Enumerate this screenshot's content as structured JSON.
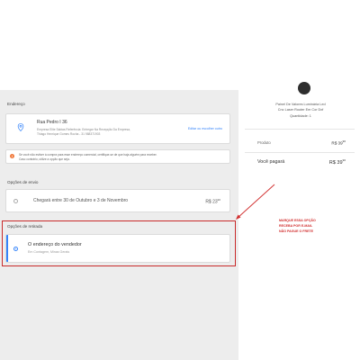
{
  "address": {
    "section_label": "Endereço",
    "street": "Rua Pedro I 36",
    "line1": "Empresa Elite Sabias Referência: Entregar Na Recepção Da Empresa,",
    "line2": "Thiago Henrique Gomes Rocha - 31 988371903",
    "change_link": "Editar ou escolher outro",
    "warning_line1": "Se você não estiver à compra para esse endereço comercial, certifique-se de que haja alguém para receber.",
    "warning_line2": "Caso contrário, utilize a opção que seja."
  },
  "shipping": {
    "section_label": "Opções de envio",
    "option_text": "Chegará entre 30 de Outubro e 3 de Novembro",
    "price_main": "R$ 23",
    "price_cents": "90"
  },
  "pickup": {
    "section_label": "Opções de retirada",
    "option_title": "O endereço do vendedor",
    "option_sub": "Em Contagem, Minas Gerais"
  },
  "summary": {
    "product_line1": "Painel De Valores Luminária Led",
    "product_line2": "Cnc Laser Router Em Cor Dxf",
    "quantity": "Quantidade: 1",
    "product_label": "Produto",
    "product_value_main": "R$ 39",
    "product_value_cents": "90",
    "total_label": "Você pagará",
    "total_value_main": "R$ 39",
    "total_value_cents": "90"
  },
  "annotation": {
    "line1": "MARQUE ESSA OPÇÃO",
    "line2": "RECEBA POR E-MAIL",
    "line3": "NÃO PAGUE O FRETE"
  },
  "colors": {
    "accent": "#3483fa",
    "annotation_red": "#d12d2d",
    "warning": "#f07a3d"
  }
}
